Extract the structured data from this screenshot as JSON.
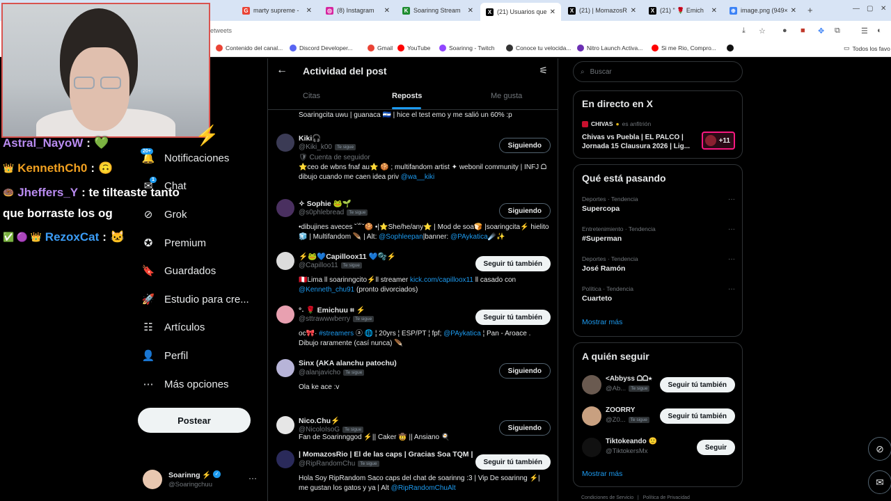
{
  "browser": {
    "tabs": [
      {
        "title": "marty supreme -",
        "color": "#ea4335",
        "icon": "G"
      },
      {
        "title": "(8) Instagram",
        "color": "#d6249f",
        "icon": "◎"
      },
      {
        "title": "Soarinng Stream",
        "color": "#1e8c2f",
        "icon": "K"
      },
      {
        "title": "(21) Usuarios que",
        "color": "#000000",
        "icon": "X",
        "active": true
      },
      {
        "title": "(21) | MomazosR",
        "color": "#000000",
        "icon": "X"
      },
      {
        "title": "(21) \" 🌹 Emich",
        "color": "#000000",
        "icon": "X"
      },
      {
        "title": "image.png (949×",
        "color": "#3b82f6",
        "icon": "⊕"
      }
    ],
    "url": "etweets",
    "bookmarks": [
      {
        "label": "Contenido del canal...",
        "color": "#ea4335"
      },
      {
        "label": "Discord Developer...",
        "color": "#5865f2"
      },
      {
        "label": "Gmail",
        "color": "#ea4335"
      },
      {
        "label": "YouTube",
        "color": "#ff0000"
      },
      {
        "label": "Soarinng - Twitch",
        "color": "#9146ff"
      },
      {
        "label": "Conoce tu velocida...",
        "color": "#333333"
      },
      {
        "label": "Nitro Launch Activa...",
        "color": "#6b2fb3"
      },
      {
        "label": "Si me Rio, Compro...",
        "color": "#ff0000"
      },
      {
        "label": "",
        "color": "#111111"
      }
    ],
    "all_bookmarks": "Todos los favo"
  },
  "stream_chat": [
    {
      "user": "Astral_NayoW",
      "user_color": "#b98bf0",
      "message": ":",
      "emote": "💚",
      "prefix": ""
    },
    {
      "user": "KennethCh0",
      "user_color": "#f0a020",
      "message": ":",
      "emote": "🙃",
      "prefix": "👑"
    },
    {
      "user": "Jheffers_Y",
      "user_color": "#b98bf0",
      "message": ": te tilteaste tanto",
      "emote": "",
      "prefix": "🍩"
    },
    {
      "user": "",
      "user_color": "#ffffff",
      "message": "que borraste los og",
      "emote": "",
      "prefix": ""
    },
    {
      "user": "RezoxCat",
      "user_color": "#3b9cf5",
      "message": ":",
      "emote": "🐱",
      "prefix": "✅ 🟣 👑"
    }
  ],
  "sidebar": {
    "notif_badge": "20+",
    "chat_badge": "1",
    "items": [
      {
        "label": "Notificaciones",
        "icon": "bell-icon"
      },
      {
        "label": "Chat",
        "icon": "chat-icon"
      },
      {
        "label": "Grok",
        "icon": "grok-icon"
      },
      {
        "label": "Premium",
        "icon": "premium-icon"
      },
      {
        "label": "Guardados",
        "icon": "bookmark-icon"
      },
      {
        "label": "Estudio para cre...",
        "icon": "rocket-icon"
      },
      {
        "label": "Artículos",
        "icon": "article-icon"
      },
      {
        "label": "Perfil",
        "icon": "person-icon"
      },
      {
        "label": "Más opciones",
        "icon": "more-icon"
      }
    ],
    "post_button": "Postear",
    "account": {
      "name": "Soarinng ⚡",
      "handle": "@Soaringchuu",
      "more": "···"
    }
  },
  "center": {
    "title": "Actividad del post",
    "tabs": [
      "Citas",
      "Reposts",
      "Me gusta"
    ],
    "active_tab": "Reposts",
    "top_partial": "Soaringcita uwu | guanaca 🇸🇻 | hice el test emo y me salió un 60% :p",
    "follows_you": "Te sigue",
    "users": [
      {
        "name": "Kiki🎧",
        "handle": "@Kiki_k00",
        "follows_you": true,
        "button": "Siguiendo",
        "button_style": "following",
        "avatar": "#3b3b55",
        "extra": "🛡 Cuenta de seguidor",
        "bio": [
          {
            "text": "⭐ceo de wbns fnaf au⭐ 🍪 ; multifandom artist ✦ webonil community | INFJ ᗝ dibujo cuando me caen idea priv "
          },
          {
            "text": "@wa__kiki",
            "link": true
          }
        ]
      },
      {
        "name": "✧ Sophie 🐸🌱",
        "handle": "@s0phlebread",
        "follows_you": true,
        "button": "Siguiendo",
        "button_style": "following",
        "avatar": "#4a3060",
        "extra": "",
        "bio": [
          {
            "text": "•dibujines aveces ˘꒳˘🍪 •|⭐She/he/any⭐ | Mod de soa🍞 |soaringcita⚡ hielito🧊 | Multifandom 🪶 | Alt: "
          },
          {
            "text": "@Sophleepan",
            "link": true
          },
          {
            "text": "|banner: "
          },
          {
            "text": "@PAykatica",
            "link": true
          },
          {
            "text": "☄️✨"
          }
        ]
      },
      {
        "name": "⚡🐸💙Capilloox11 💙🫧⚡",
        "handle": "@Capilloo11",
        "follows_you": true,
        "button": "Seguir tú también",
        "button_style": "follow",
        "avatar": "#dcdcdc",
        "extra": "",
        "bio": [
          {
            "text": "🇵🇪Lima ll soarinngcito⚡ll streamer "
          },
          {
            "text": "kick.com/capilloox11",
            "link": true
          },
          {
            "text": " ll casado con "
          },
          {
            "text": "@Kenneth_chu91",
            "link": true
          },
          {
            "text": " (pronto divorciados)"
          }
        ]
      },
      {
        "name": "°˖ 🌹 Emichuu ⌗ ⚡",
        "handle": "@sttrawwwberry",
        "follows_you": true,
        "button": "Seguir tú también",
        "button_style": "follow",
        "avatar": "#e8a0b0",
        "extra": "",
        "bio": [
          {
            "text": "ᴏᴄ🎀· "
          },
          {
            "text": "#streamers",
            "link": true
          },
          {
            "text": " ⓐ 🌐 ¦ 20yrs ¦ ESP/PT ¦ fpf; "
          },
          {
            "text": "@PAykatica",
            "link": true
          },
          {
            "text": " ¦ Pan - Aroace . Dibujo raramente (casí nunca) 🪶"
          }
        ]
      },
      {
        "name": "Sinx (AKA alanchu patochu)",
        "handle": "@alanjavicho",
        "follows_you": true,
        "button": "Siguiendo",
        "button_style": "following",
        "avatar": "#b7b4d8",
        "extra": "",
        "bio": [
          {
            "text": "Ola ke ace :v"
          }
        ]
      },
      {
        "name": "Nico.Chu⚡",
        "handle": "@NicoloIsoG",
        "follows_you": true,
        "button": "Siguiendo",
        "button_style": "following",
        "avatar": "#e6e6e6",
        "extra": "",
        "bio": [
          {
            "text": "Fan de Soarinnggod ⚡|| Caker 🤠 || Ansiano 🍳"
          }
        ]
      },
      {
        "name": "| MomazosRio | El de las caps | Gracias Soa TQM |",
        "handle": "@RipRandomChu",
        "follows_you": true,
        "button": "Seguir tú también",
        "button_style": "follow",
        "avatar": "#2a2a5a",
        "extra": "",
        "bio": [
          {
            "text": "Hola Soy RipRandom Saco caps del chat de soarinng :3 | Vip De soarinng ⚡| me gustan los gatos y ya | Alt "
          },
          {
            "text": "@RipRandomChuAlt",
            "link": true
          }
        ]
      }
    ]
  },
  "right": {
    "search_placeholder": "Buscar",
    "live": {
      "title": "En directo en X",
      "host": "CHIVAS",
      "host_suffix": "es anfitrión",
      "event": "Chivas vs Puebla | EL PALCO | Jornada 15 Clausura 2026 | Lig...",
      "count": "+11"
    },
    "trends_title": "Qué está pasando",
    "trends": [
      {
        "category": "Deportes · Tendencia",
        "name": "Supercopa"
      },
      {
        "category": "Entretenimiento · Tendencia",
        "name": "#Superman"
      },
      {
        "category": "Deportes · Tendencia",
        "name": "José Ramón"
      },
      {
        "category": "Política · Tendencia",
        "name": "Cuarteto"
      }
    ],
    "show_more": "Mostrar más",
    "who_title": "A quién seguir",
    "who": [
      {
        "name": "<Abbyss ᗝᗝ⭑",
        "handle": "@Ab...",
        "follows_you": true,
        "button": "Seguir tú también",
        "avatar": "#6a5a50"
      },
      {
        "name": "ZOORRY",
        "handle": "@Z0...",
        "follows_you": true,
        "button": "Seguir tú también",
        "avatar": "#c8a080"
      },
      {
        "name": "Tiktokeando 🙂",
        "handle": "@TiktokersMx",
        "follows_you": false,
        "button": "Seguir",
        "avatar": "#111111"
      }
    ],
    "footer": "Condiciones de Servicio   |   Política de Privacidad"
  }
}
